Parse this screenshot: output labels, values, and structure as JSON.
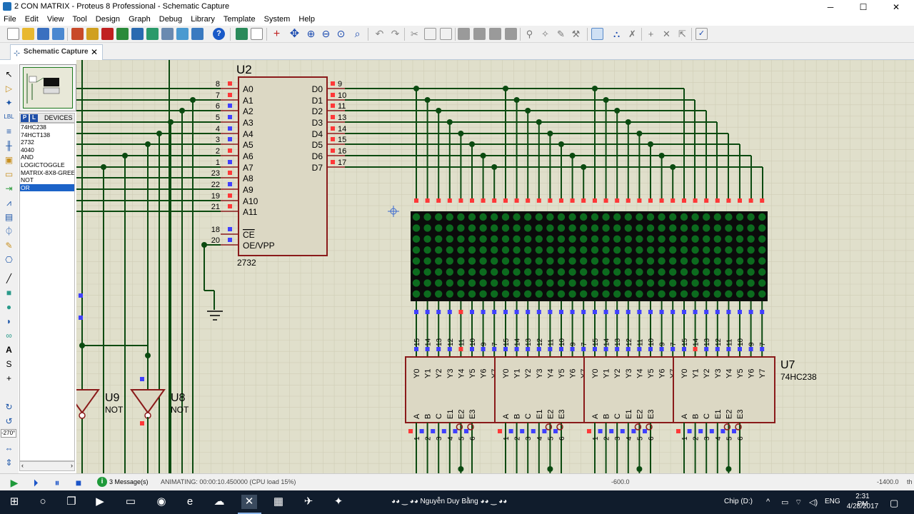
{
  "window": {
    "title": "2 CON MATRIX - Proteus 8 Professional - Schematic Capture",
    "min_icon": "minimize-icon",
    "max_icon": "maximize-icon",
    "close_icon": "close-icon"
  },
  "menu": [
    "File",
    "Edit",
    "View",
    "Tool",
    "Design",
    "Graph",
    "Debug",
    "Library",
    "Template",
    "System",
    "Help"
  ],
  "tab": {
    "label": "Schematic Capture",
    "close": "✕"
  },
  "devices": {
    "header": "DEVICES",
    "p_button": "P",
    "l_button": "L",
    "items": [
      "74HC238",
      "74HCT138",
      "2732",
      "4040",
      "AND",
      "LOGICTOGGLE",
      "MATRIX-8X8-GREEN",
      "NOT",
      "OR"
    ],
    "selected_index": 8
  },
  "rotation_value": "-270°",
  "schematic": {
    "u2": {
      "ref": "U2",
      "part": "2732",
      "left_pins": [
        {
          "num": "8",
          "name": "A0"
        },
        {
          "num": "7",
          "name": "A1"
        },
        {
          "num": "6",
          "name": "A2"
        },
        {
          "num": "5",
          "name": "A3"
        },
        {
          "num": "4",
          "name": "A4"
        },
        {
          "num": "3",
          "name": "A5"
        },
        {
          "num": "2",
          "name": "A6"
        },
        {
          "num": "1",
          "name": "A7"
        },
        {
          "num": "23",
          "name": "A8"
        },
        {
          "num": "22",
          "name": "A9"
        },
        {
          "num": "19",
          "name": "A10"
        },
        {
          "num": "21",
          "name": "A11"
        },
        {
          "num": "18",
          "name": "CE"
        },
        {
          "num": "20",
          "name": "OE/VPP"
        }
      ],
      "right_pins": [
        {
          "num": "9",
          "name": "D0"
        },
        {
          "num": "10",
          "name": "D1"
        },
        {
          "num": "11",
          "name": "D2"
        },
        {
          "num": "13",
          "name": "D3"
        },
        {
          "num": "14",
          "name": "D4"
        },
        {
          "num": "15",
          "name": "D5"
        },
        {
          "num": "16",
          "name": "D6"
        },
        {
          "num": "17",
          "name": "D7"
        }
      ]
    },
    "u7": {
      "ref": "U7",
      "part": "74HC238"
    },
    "u8": {
      "ref": "U8",
      "part": "NOT"
    },
    "u9": {
      "ref": "U9",
      "part": "NOT"
    },
    "decoder_top_pins": [
      "15",
      "14",
      "13",
      "12",
      "11",
      "10",
      "9",
      "7"
    ],
    "decoder_outputs": [
      "Y0",
      "Y1",
      "Y2",
      "Y3",
      "Y4",
      "Y5",
      "Y6",
      "Y7"
    ],
    "decoder_inputs": [
      "A",
      "B",
      "C",
      "E1",
      "E2",
      "E3"
    ],
    "decoder_bottom_pins": [
      "1",
      "2",
      "3",
      "4",
      "5",
      "6"
    ],
    "matrix_count": 4,
    "decoder_count": 4
  },
  "status": {
    "messages": "3 Message(s)",
    "animating": "ANIMATING: 00:00:10.450000 (CPU load 15%)",
    "coord_x": "-600.0",
    "coord_y": "-1400.0",
    "units": "th"
  },
  "taskbar": {
    "user_text": "◕◕ ‿ ◕◕ Nguyễn Duy Bằng ◕◕ ‿ ◕◕",
    "chip_text": "Chip (D:)",
    "lang": "ENG",
    "time": "2:31 PM",
    "date": "4/28/2017"
  },
  "colors": {
    "canvas_bg": "#e0dfcb",
    "wire": "#0b4a10",
    "chip_fill": "#dcd8c4",
    "chip_border": "#8a1a1a",
    "matrix_bg": "#0b0b0b",
    "led_off": "#0c6b1e",
    "pin_red": "#ff3838",
    "pin_blue": "#4040ff"
  }
}
